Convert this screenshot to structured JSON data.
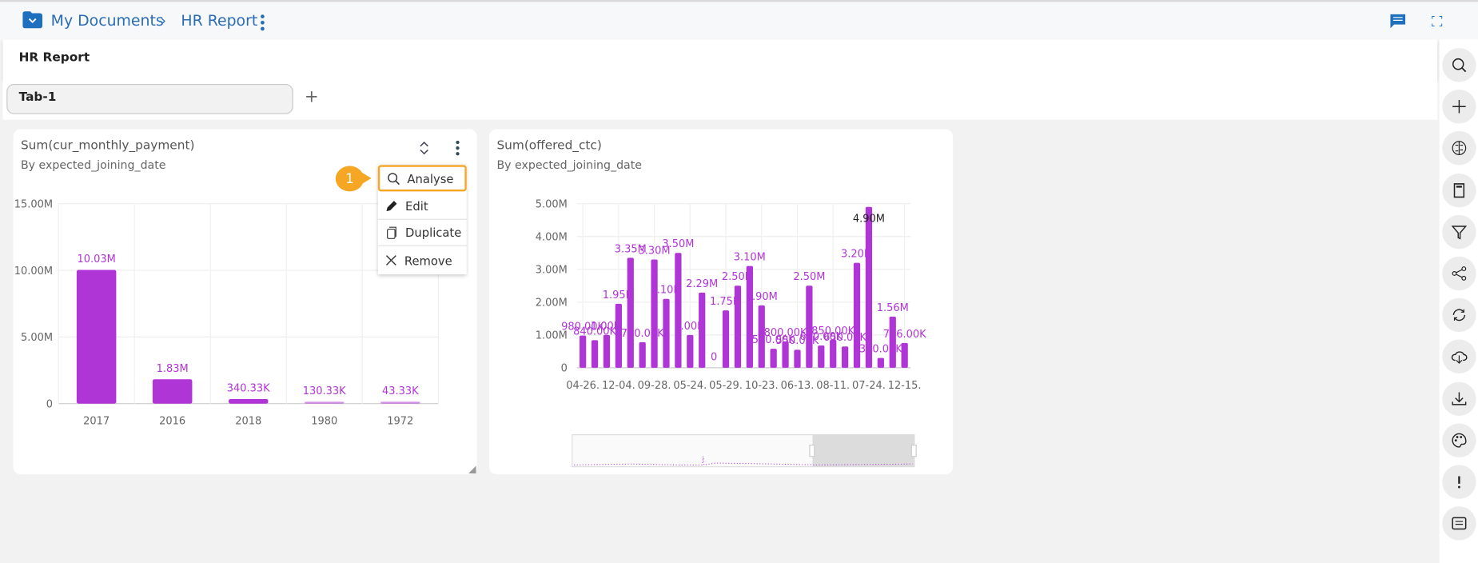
{
  "breadcrumb": {
    "root": "My Documents",
    "current": "HR Report"
  },
  "header": {
    "title": "HR Report"
  },
  "tabs": [
    {
      "label": "Tab-1"
    }
  ],
  "accent": "#b035d6",
  "menu": {
    "items": [
      {
        "label": "Analyse",
        "icon": "search-icon"
      },
      {
        "label": "Edit",
        "icon": "pencil-icon"
      },
      {
        "label": "Duplicate",
        "icon": "copy-icon"
      },
      {
        "label": "Remove",
        "icon": "close-icon"
      }
    ],
    "callout": "1"
  },
  "sidebar": {
    "icons": [
      "search-icon",
      "plus-icon",
      "brain-icon",
      "sd-card-icon",
      "filter-icon",
      "share-icon",
      "refresh-icon",
      "cloud-download-icon",
      "download-icon",
      "palette-icon",
      "info-icon",
      "message-icon"
    ]
  },
  "chart_data": [
    {
      "type": "bar",
      "title": "Sum(cur_monthly_payment)",
      "subtitle": "By expected_joining_date",
      "categories": [
        "2017",
        "2016",
        "2018",
        "1980",
        "1972"
      ],
      "values": [
        10030000,
        1830000,
        340330,
        130330,
        43330
      ],
      "labels": [
        "10.03M",
        "1.83M",
        "340.33K",
        "130.33K",
        "43.33K"
      ],
      "yticks": [
        "0",
        "5.00M",
        "10.00M",
        "15.00M"
      ],
      "ylim": [
        0,
        15000000
      ],
      "grid": true
    },
    {
      "type": "bar",
      "title": "Sum(offered_ctc)",
      "subtitle": "By expected_joining_date",
      "values": [
        980000,
        840000,
        1000000,
        1950000,
        3350000,
        780000,
        3300000,
        2100000,
        3500000,
        1000000,
        2290000,
        0,
        1750000,
        2500000,
        3100000,
        1900000,
        580000,
        800000,
        550000,
        2500000,
        680000,
        850000,
        650000,
        3200000,
        4900000,
        300000,
        1560000,
        756000
      ],
      "labels": [
        "980.00K",
        "840.00K",
        "1.00M",
        "1.95M",
        "3.35M",
        "780.00K",
        "3.30M",
        "2.10M",
        "3.50M",
        "1.00M",
        "2.29M",
        "0",
        "1.75M",
        "2.50M",
        "3.10M",
        "1.90M",
        "580.00K",
        "800.00K",
        "550.00K",
        "2.50M",
        "680.00K",
        "850.00K",
        "650.00K",
        "3.20M",
        "4.90M",
        "300.00K",
        "1.56M",
        "756.00K"
      ],
      "xticks": [
        "04-26.",
        "12-04.",
        "09-28.",
        "05-24.",
        "05-29.",
        "10-23.",
        "06-13.",
        "08-11.",
        "07-24.",
        "12-15."
      ],
      "yticks": [
        "0",
        "1.00M",
        "2.00M",
        "3.00M",
        "4.00M",
        "5.00M"
      ],
      "ylim": [
        0,
        5000000
      ],
      "grid": true,
      "navigator": true
    }
  ]
}
